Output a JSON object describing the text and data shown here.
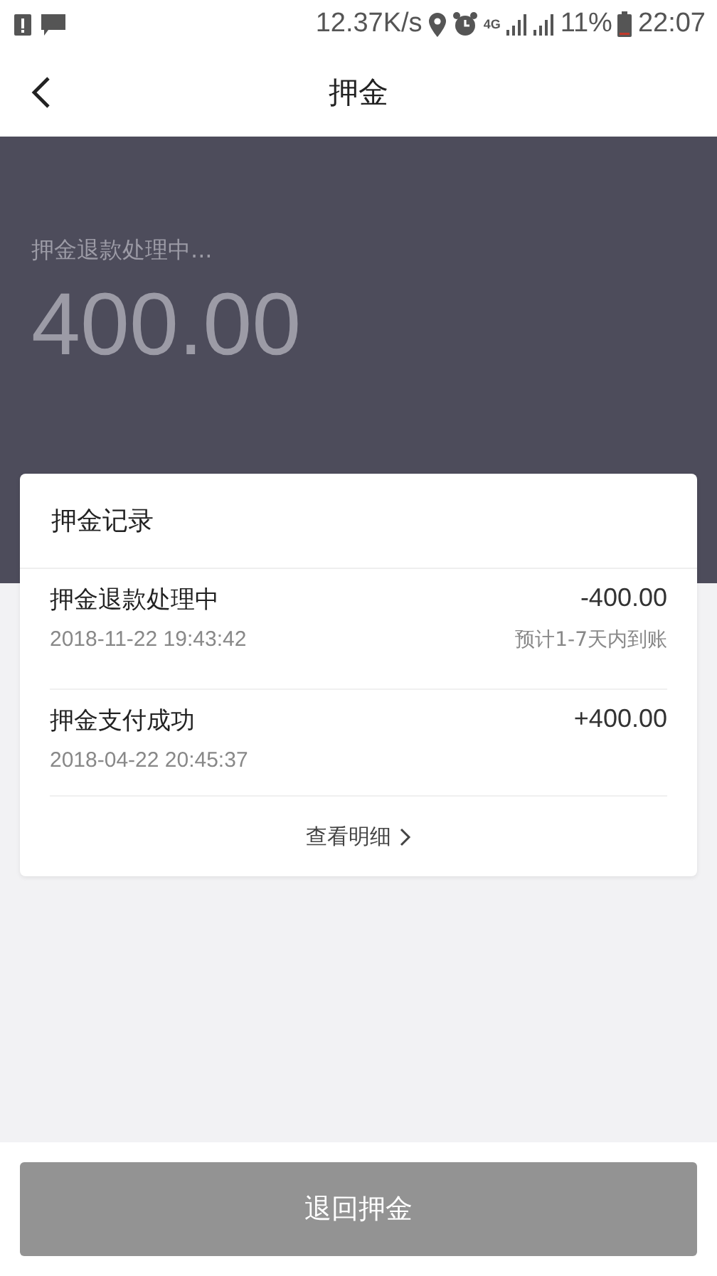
{
  "status_bar": {
    "speed": "12.37K/s",
    "network": "4G",
    "battery": "11%",
    "time": "22:07"
  },
  "nav": {
    "title": "押金"
  },
  "deposit": {
    "status": "押金退款处理中...",
    "amount": "400.00"
  },
  "records": {
    "title": "押金记录",
    "items": [
      {
        "name": "押金退款处理中",
        "time": "2018-11-22 19:43:42",
        "amount": "-400.00",
        "note": "预计1-7天内到账"
      },
      {
        "name": "押金支付成功",
        "time": "2018-04-22 20:45:37",
        "amount": "+400.00"
      }
    ],
    "details_link": "查看明细"
  },
  "refund_button": {
    "label": "退回押金",
    "disabled": true
  }
}
